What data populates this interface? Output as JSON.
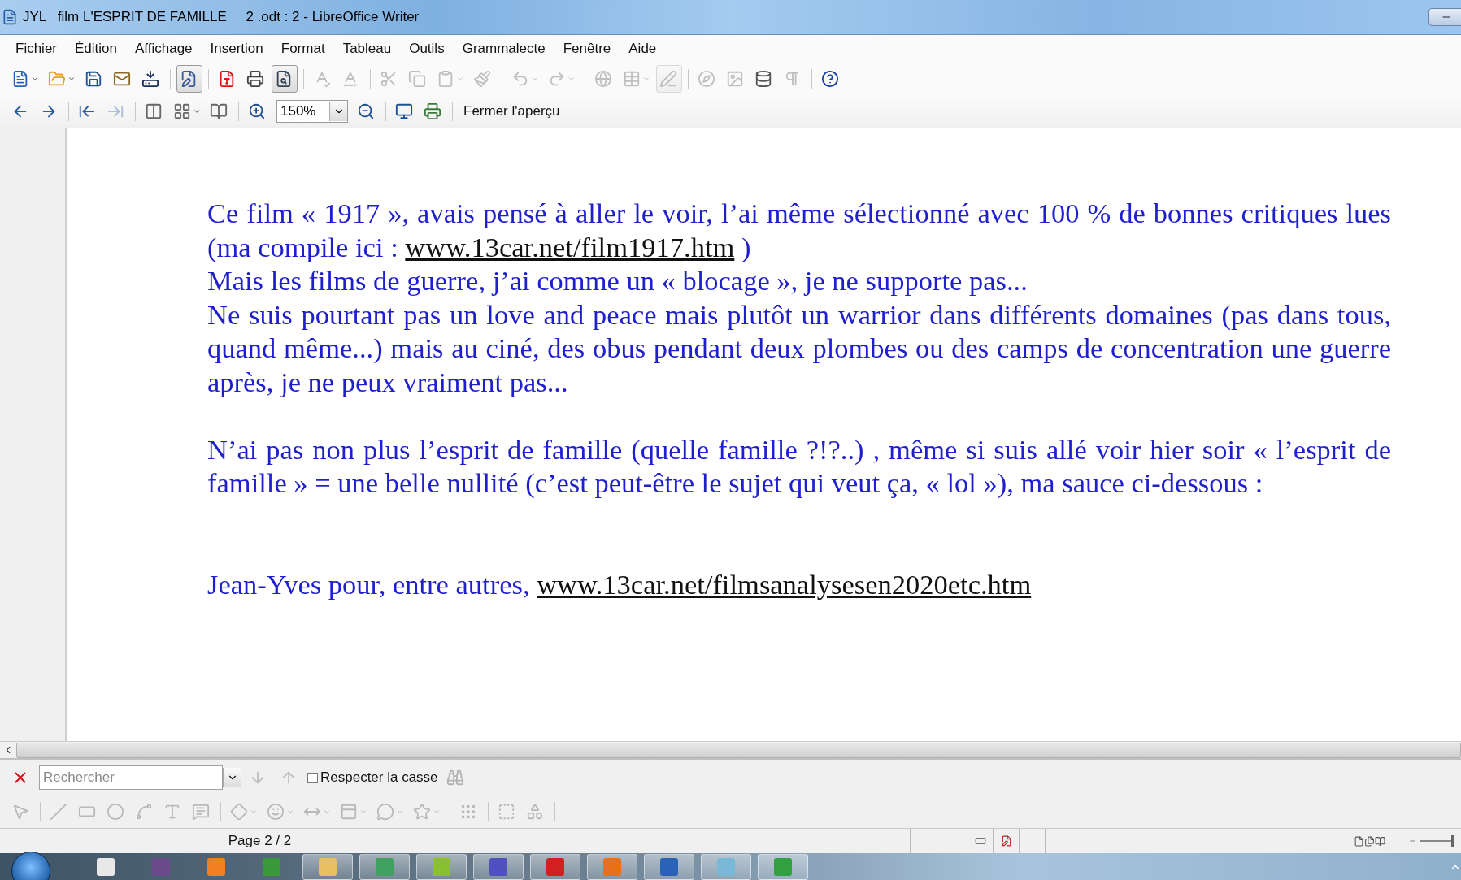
{
  "window": {
    "title": "JYL   film L'ESPRIT DE FAMILLE     2 .odt : 2 - LibreOffice Writer"
  },
  "menu": [
    "Fichier",
    "Édition",
    "Affichage",
    "Insertion",
    "Format",
    "Tableau",
    "Outils",
    "Grammalecte",
    "Fenêtre",
    "Aide"
  ],
  "standard_toolbar": [
    {
      "disabled": false,
      "pressed": false
    },
    {
      "disabled": false,
      "pressed": false
    },
    {
      "disabled": false,
      "pressed": false
    },
    {
      "disabled": false,
      "pressed": false
    },
    {
      "disabled": false,
      "pressed": false
    },
    {
      "disabled": false,
      "pressed": true
    },
    {
      "disabled": false,
      "pressed": false
    },
    {
      "disabled": false,
      "pressed": false
    },
    {
      "disabled": false,
      "pressed": true
    },
    {
      "disabled": true,
      "pressed": false
    },
    {
      "disabled": true,
      "pressed": false
    },
    {
      "disabled": true,
      "pressed": false
    },
    {
      "disabled": true,
      "pressed": false
    },
    {
      "disabled": true,
      "pressed": false
    },
    {
      "disabled": true,
      "pressed": false
    },
    {
      "disabled": true,
      "pressed": false
    },
    {
      "disabled": true,
      "pressed": false
    },
    {
      "disabled": true,
      "pressed": false
    },
    {
      "disabled": true,
      "pressed": false
    },
    {
      "disabled": true,
      "pressed": true
    },
    {
      "disabled": true,
      "pressed": false
    },
    {
      "disabled": true,
      "pressed": false
    },
    {
      "disabled": false,
      "pressed": false
    },
    {
      "disabled": true,
      "pressed": false
    },
    {
      "disabled": false,
      "pressed": false
    }
  ],
  "preview_toolbar": {
    "buttons": [
      {
        "disabled": false
      },
      {
        "disabled": false
      },
      {
        "disabled": false
      },
      {
        "disabled": true
      },
      {
        "disabled": false
      },
      {
        "disabled": false
      },
      {
        "disabled": false
      },
      {
        "disabled": false
      },
      {
        "disabled": false
      },
      {
        "disabled": false
      },
      {
        "disabled": false
      }
    ],
    "zoom": "150%",
    "close_label": "Fermer l'aperçu"
  },
  "document": {
    "paragraphs": [
      {
        "kind": "text",
        "parts": [
          {
            "kind": "text",
            "text": "Ce film « 1917 », avais pensé à aller le voir, l’ai même sélectionné avec 100 % de bonnes critiques lues (ma compile ici  :  "
          },
          {
            "kind": "link",
            "text": "www.13car.net/film1917.htm"
          },
          {
            "kind": "text",
            "text": " )"
          }
        ]
      },
      {
        "kind": "text",
        "parts": [
          {
            "kind": "text",
            "text": "Mais les films de guerre, j’ai comme un « blocage », je ne supporte pas..."
          }
        ]
      },
      {
        "kind": "text",
        "parts": [
          {
            "kind": "text",
            "text": "Ne suis pourtant pas un love and peace mais plutôt un warrior dans différents domaines (pas dans tous, quand même...) mais au ciné, des obus pendant deux plombes ou des camps de concentration une guerre après, je ne peux vraiment pas..."
          }
        ]
      },
      {
        "kind": "empty"
      },
      {
        "kind": "text",
        "parts": [
          {
            "kind": "text",
            "text": "N’ai pas non plus l’esprit de famille (quelle famille ?!?..) , même si suis allé voir hier soir « l’esprit de famille » = une belle nullité (c’est peut-être le sujet qui veut ça, « lol »), ma sauce ci-dessous :"
          }
        ]
      },
      {
        "kind": "empty"
      },
      {
        "kind": "empty"
      },
      {
        "kind": "text",
        "parts": [
          {
            "kind": "text",
            "text": "Jean-Yves pour, entre autres, "
          },
          {
            "kind": "link",
            "text": "www.13car.net/filmsanalysesen2020etc.htm"
          }
        ]
      }
    ]
  },
  "find_toolbar": {
    "placeholder": "Rechercher",
    "next_disabled": true,
    "prev_disabled": true,
    "match_case": {
      "label": "Respecter la casse",
      "checked": false
    },
    "find_all_disabled": true
  },
  "drawing_toolbar": [
    {
      "disabled": true
    },
    {
      "disabled": true
    },
    {
      "disabled": true
    },
    {
      "disabled": true
    },
    {
      "disabled": true
    },
    {
      "disabled": true
    },
    {
      "disabled": true
    },
    {
      "disabled": true
    },
    {
      "disabled": true
    },
    {
      "disabled": true
    },
    {
      "disabled": true
    },
    {
      "disabled": true
    },
    {
      "disabled": true
    },
    {
      "disabled": true
    },
    {
      "disabled": true
    },
    {
      "disabled": true
    }
  ],
  "status_bar": {
    "page": "Page 2 / 2",
    "zoom_slider": {
      "level": 0.97
    }
  }
}
